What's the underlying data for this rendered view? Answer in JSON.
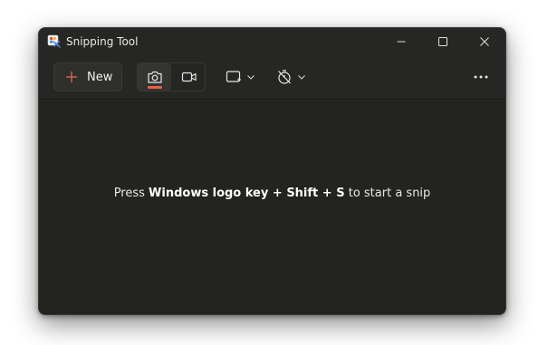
{
  "window": {
    "title": "Snipping Tool"
  },
  "title_bar": {
    "icons": [
      "snipping-tool-app-icon",
      "minimize-icon",
      "maximize-icon",
      "close-icon"
    ]
  },
  "toolbar": {
    "new_label": "New",
    "new_icon": "plus-icon",
    "modes": [
      {
        "name": "screenshot",
        "icon": "camera-icon",
        "selected": true
      },
      {
        "name": "record",
        "icon": "video-icon",
        "selected": false
      }
    ],
    "snip_shape_icon": "rectangle-snip-icon",
    "delay_icon": "no-timer-icon",
    "more_icon": "more-icon"
  },
  "hint": {
    "prefix": "Press ",
    "key1": "Windows logo key",
    "sep1": " + ",
    "key2": "Shift",
    "sep2": " + ",
    "key3": "S",
    "suffix": " to start a snip"
  },
  "colors": {
    "background": "#232320",
    "toolbar": "#262624",
    "accent": "#e8624b",
    "new_plus": "#e26a55",
    "text": "#e8e8e8"
  }
}
